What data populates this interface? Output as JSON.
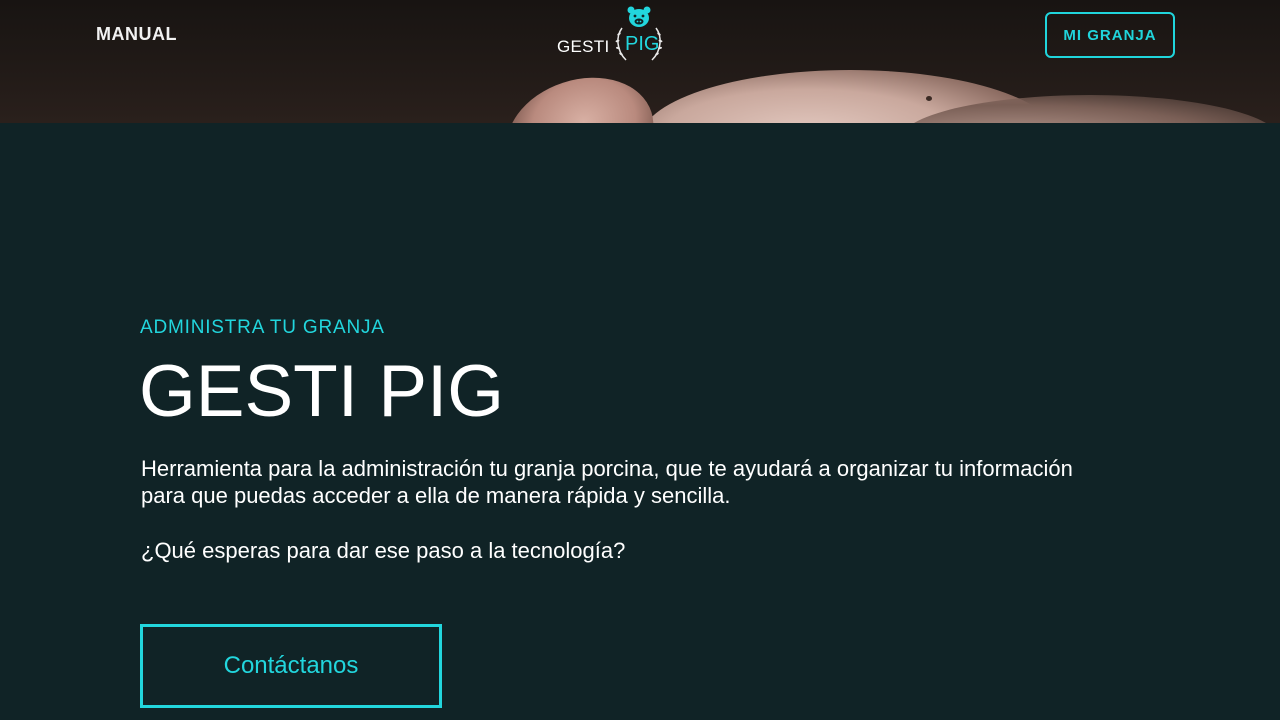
{
  "nav": {
    "manual_label": "MANUAL",
    "account_button": "MI GRANJA"
  },
  "logo": {
    "left_text": "GESTI",
    "right_text": "PIG",
    "icon": "pig-head-icon"
  },
  "hero": {
    "eyebrow": "ADMINISTRA TU GRANJA",
    "title": "GESTI PIG",
    "description": "Herramienta para la administración tu granja porcina, que te ayudará a organizar tu información para que puedas acceder a ella de manera rápida y sencilla.",
    "question": "¿Qué esperas para dar ese paso a la tecnología?",
    "cta_label": "Contáctanos"
  },
  "colors": {
    "accent": "#22d6dd",
    "background": "#102326",
    "text": "#ffffff"
  }
}
